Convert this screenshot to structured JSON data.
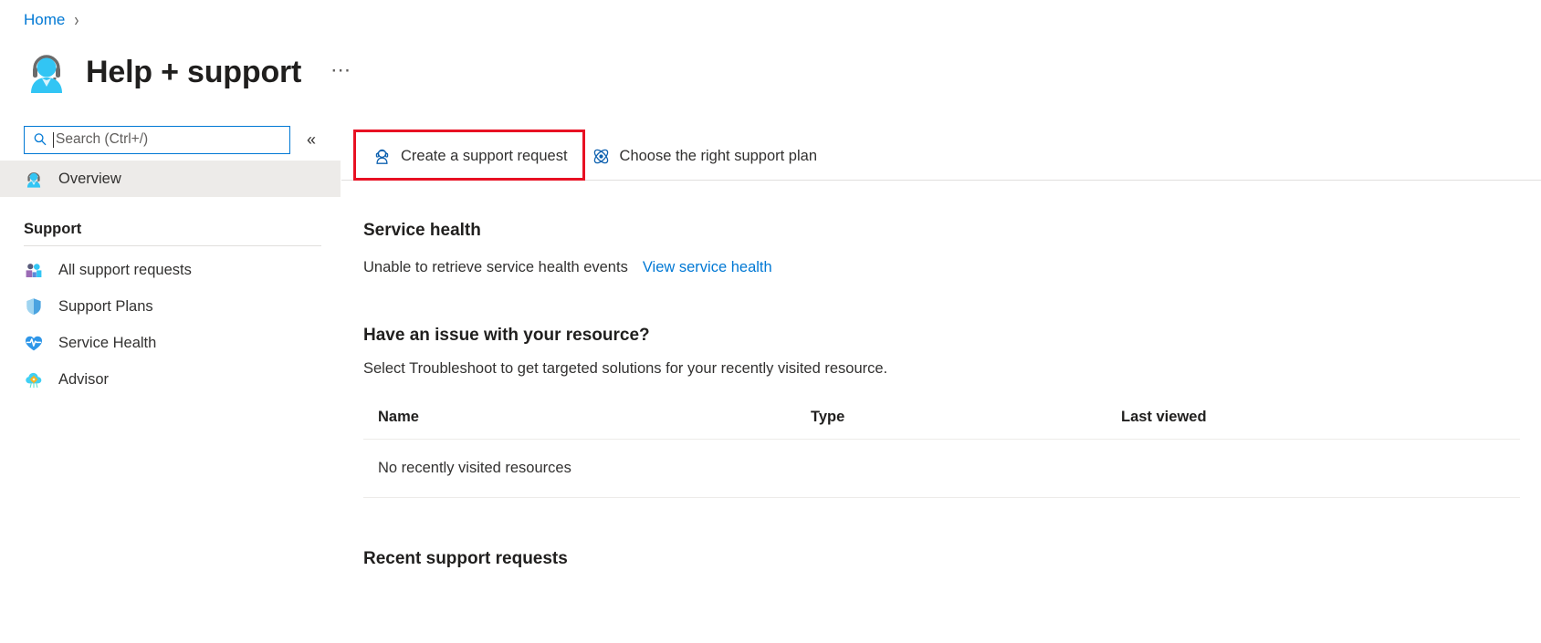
{
  "breadcrumb": {
    "home_label": "Home",
    "separator": "›"
  },
  "header": {
    "title": "Help + support",
    "icon": "support-agent-icon",
    "more_label": "⋯"
  },
  "sidebar": {
    "search": {
      "placeholder": "Search (Ctrl+/)",
      "value": "",
      "icon": "search-icon"
    },
    "collapse_label": "«",
    "overview": {
      "label": "Overview",
      "icon": "support-agent-icon",
      "selected": true
    },
    "group_title": "Support",
    "items": [
      {
        "label": "All support requests",
        "icon": "people-requests-icon"
      },
      {
        "label": "Support Plans",
        "icon": "shield-icon"
      },
      {
        "label": "Service Health",
        "icon": "heart-pulse-icon"
      },
      {
        "label": "Advisor",
        "icon": "cloud-gear-icon"
      }
    ]
  },
  "commandbar": {
    "buttons": [
      {
        "label": "Create a support request",
        "icon": "create-support-request-icon",
        "highlighted": true
      },
      {
        "label": "Choose the right support plan",
        "icon": "atom-icon",
        "highlighted": false
      }
    ],
    "highlight_color": "#e81123"
  },
  "main": {
    "service_health": {
      "heading": "Service health",
      "status_text": "Unable to retrieve service health events",
      "link_label": "View service health"
    },
    "resource_issue": {
      "heading": "Have an issue with your resource?",
      "subtext": "Select Troubleshoot to get targeted solutions for your recently visited resource.",
      "columns": [
        "Name",
        "Type",
        "Last viewed"
      ],
      "rows": [
        [
          "No recently visited resources",
          "",
          ""
        ]
      ]
    },
    "recent_requests": {
      "heading": "Recent support requests"
    }
  },
  "colors": {
    "accent": "#0078d4",
    "icon_cyan": "#32c5f4",
    "text": "#323130",
    "selected_bg": "#edebe9"
  }
}
